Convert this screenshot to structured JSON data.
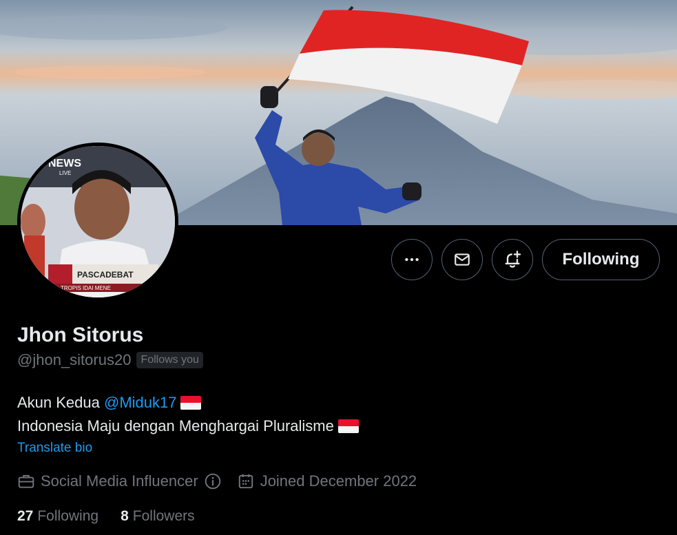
{
  "profile": {
    "name": "Jhon Sitorus",
    "handle": "@jhon_sitorus20",
    "follows_you": "Follows you"
  },
  "actions": {
    "more": "more-icon",
    "message": "mail-icon",
    "notify": "bell-plus-icon",
    "following_label": "Following"
  },
  "bio": {
    "line1_prefix": "Akun Kedua ",
    "line1_mention": "@Miduk17",
    "line2": "Indonesia Maju dengan Menghargai Pluralisme",
    "translate": "Translate bio"
  },
  "meta": {
    "category": "Social Media Influencer",
    "joined": "Joined December 2022"
  },
  "stats": {
    "following_count": "27",
    "following_label": "Following",
    "followers_count": "8",
    "followers_label": "Followers"
  },
  "banner": {
    "avatar_caption_news": "NEWS",
    "avatar_caption_live": "LIVE",
    "avatar_caption_bar": "PASCADEBAT",
    "avatar_caption_sub": "TROPIS IDAI MENE"
  },
  "colors": {
    "accent": "#1d9bf0",
    "muted": "#71767b",
    "text": "#e7e9ea",
    "border": "#536471"
  }
}
